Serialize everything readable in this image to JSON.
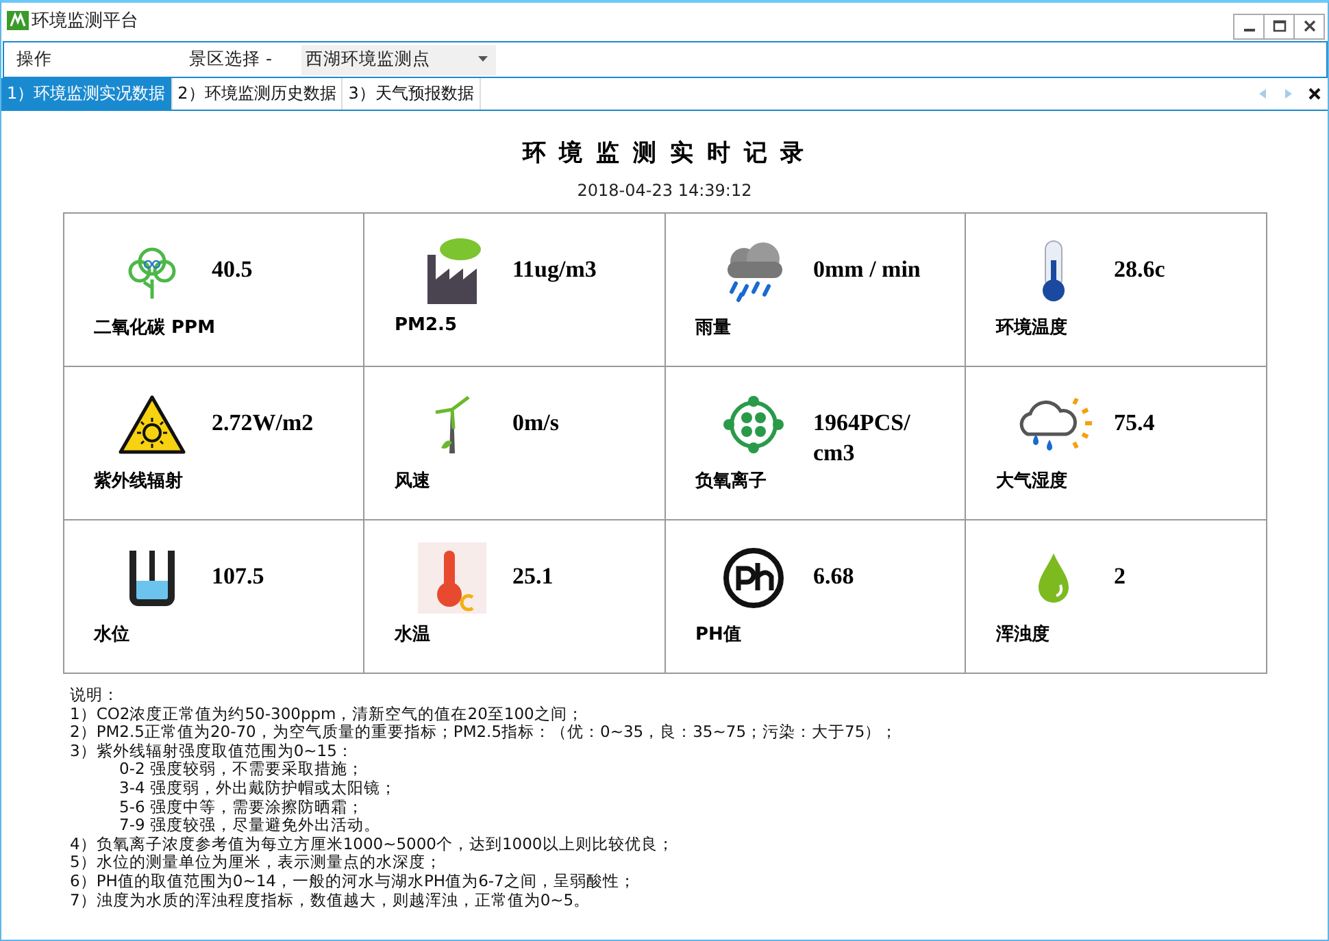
{
  "window": {
    "title": "环境监测平台"
  },
  "menu": {
    "label": "操作",
    "area_label": "景区选择 -",
    "area_value": "西湖环境监测点"
  },
  "tabs": [
    {
      "label": "1）环境监测实况数据",
      "selected": true
    },
    {
      "label": "2）环境监测历史数据",
      "selected": false
    },
    {
      "label": "3）天气预报数据",
      "selected": false
    }
  ],
  "report": {
    "title": "环 境 监 测 实 时 记 录",
    "time": "2018-04-23 14:39:12"
  },
  "readings": [
    {
      "kind": "co2",
      "value": "40.5",
      "label": "二氧化碳 PPM"
    },
    {
      "kind": "pm",
      "value": "11ug/m3",
      "label": "PM2.5"
    },
    {
      "kind": "rain",
      "value": "0mm / min",
      "label": "雨量"
    },
    {
      "kind": "temp",
      "value": "28.6c",
      "label": "环境温度"
    },
    {
      "kind": "uv",
      "value": "2.72W/m2",
      "label": "紫外线辐射"
    },
    {
      "kind": "wind",
      "value": "0m/s",
      "label": "风速"
    },
    {
      "kind": "ion",
      "value": "1964PCS/ cm3",
      "label": "负氧离子"
    },
    {
      "kind": "humidity",
      "value": "75.4",
      "label": "大气湿度"
    },
    {
      "kind": "level",
      "value": "107.5",
      "label": "水位"
    },
    {
      "kind": "watertemp",
      "value": "25.1",
      "label": "水温"
    },
    {
      "kind": "ph",
      "value": "6.68",
      "label": "PH值"
    },
    {
      "kind": "turbidity",
      "value": "2",
      "label": "浑浊度"
    }
  ],
  "notes": {
    "heading": "说明：",
    "items": [
      {
        "text": "1）CO2浓度正常值为约50-300ppm，清新空气的值在20至100之间；"
      },
      {
        "text": "2）PM2.5正常值为20-70，为空气质量的重要指标；PM2.5指标：（优：0~35，良：35~75；污染：大于75）；"
      },
      {
        "text": "3）紫外线辐射强度取值范围为0~15：",
        "children": [
          {
            "text": "0-2 强度较弱，不需要采取措施；"
          },
          {
            "text": "3-4 强度弱，外出戴防护帽或太阳镜；"
          },
          {
            "text": "5-6 强度中等，需要涂擦防晒霜；"
          },
          {
            "text": "7-9 强度较强，尽量避免外出活动。"
          }
        ]
      },
      {
        "text": "4）负氧离子浓度参考值为每立方厘米1000~5000个，达到1000以上则比较优良；"
      },
      {
        "text": "5）水位的测量单位为厘米，表示测量点的水深度；"
      },
      {
        "text": "6）PH值的取值范围为0~14，一般的河水与湖水PH值为6-7之间，呈弱酸性；"
      },
      {
        "text": "7）浊度为水质的浑浊程度指标，数值越大，则越浑浊，正常值为0~5。"
      }
    ]
  }
}
